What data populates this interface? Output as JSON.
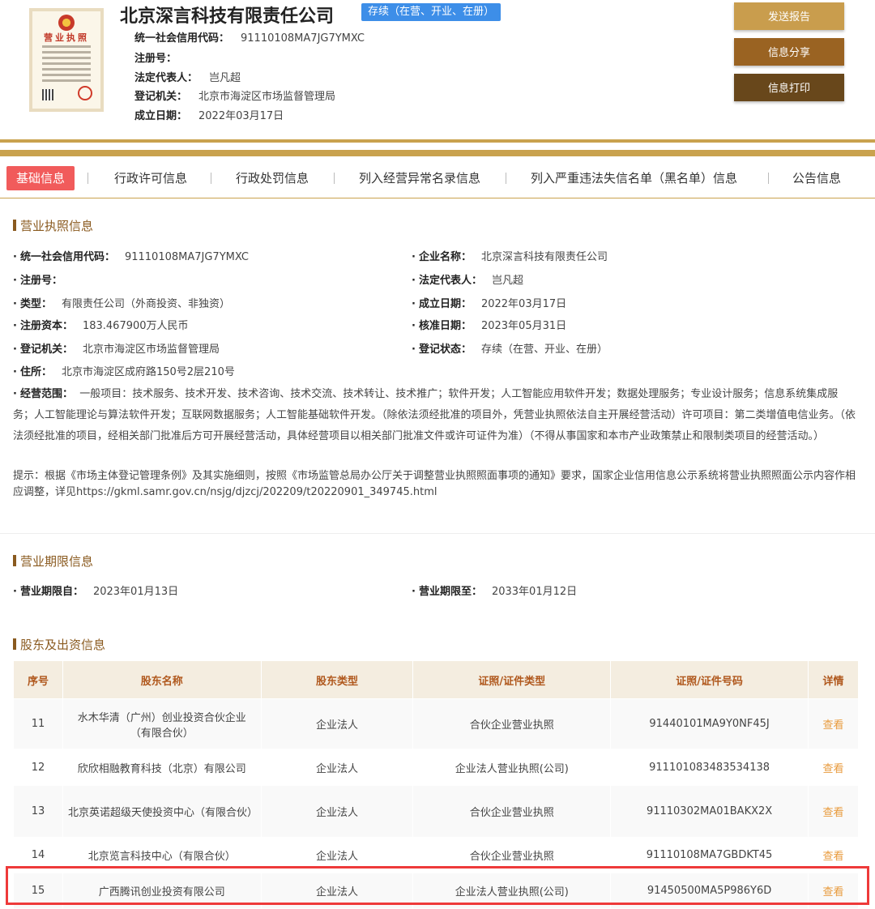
{
  "header": {
    "company_name": "北京深言科技有限责任公司",
    "status_badge": "存续（在营、开业、在册）",
    "rows": [
      {
        "label": "统一社会信用代码：",
        "value": "91110108MA7JG7YMXC"
      },
      {
        "label": "注册号：",
        "value": ""
      },
      {
        "label": "法定代表人：",
        "value": "岂凡超"
      },
      {
        "label": "登记机关：",
        "value": "北京市海淀区市场监督管理局"
      },
      {
        "label": "成立日期：",
        "value": "2022年03月17日"
      }
    ],
    "buttons": {
      "send_report": "发送报告",
      "share": "信息分享",
      "print": "信息打印"
    },
    "license_title": "营业执照"
  },
  "tabs": [
    "基础信息",
    "行政许可信息",
    "行政处罚信息",
    "列入经营异常名录信息",
    "列入严重违法失信名单（黑名单）信息",
    "公告信息"
  ],
  "license_section": {
    "title": "营业执照信息",
    "left": [
      {
        "label": "统一社会信用代码：",
        "value": "91110108MA7JG7YMXC"
      },
      {
        "label": "注册号：",
        "value": ""
      },
      {
        "label": "类型：",
        "value": "有限责任公司（外商投资、非独资）"
      },
      {
        "label": "注册资本：",
        "value": "183.467900万人民币"
      },
      {
        "label": "登记机关：",
        "value": "北京市海淀区市场监督管理局"
      },
      {
        "label": "住所：",
        "value": "北京市海淀区成府路150号2层210号"
      }
    ],
    "right": [
      {
        "label": "企业名称：",
        "value": "北京深言科技有限责任公司"
      },
      {
        "label": "法定代表人：",
        "value": "岂凡超"
      },
      {
        "label": "成立日期：",
        "value": "2022年03月17日"
      },
      {
        "label": "核准日期：",
        "value": "2023年05月31日"
      },
      {
        "label": "登记状态：",
        "value": "存续（在营、开业、在册）"
      }
    ],
    "scope_label": "经营范围：",
    "scope_value": "一般项目：技术服务、技术开发、技术咨询、技术交流、技术转让、技术推广；软件开发；人工智能应用软件开发；数据处理服务；专业设计服务；信息系统集成服务；人工智能理论与算法软件开发；互联网数据服务；人工智能基础软件开发。（除依法须经批准的项目外，凭营业执照依法自主开展经营活动）许可项目：第二类增值电信业务。（依法须经批准的项目，经相关部门批准后方可开展经营活动，具体经营项目以相关部门批准文件或许可证件为准）（不得从事国家和本市产业政策禁止和限制类项目的经营活动。）",
    "tip": "提示：根据《市场主体登记管理条例》及其实施细则，按照《市场监管总局办公厅关于调整营业执照照面事项的通知》要求，国家企业信用信息公示系统将营业执照照面公示内容作相应调整，详见https://gkml.samr.gov.cn/nsjg/djzcj/202209/t20220901_349745.html"
  },
  "term_section": {
    "title": "营业期限信息",
    "from_label": "营业期限自：",
    "from_value": "2023年01月13日",
    "to_label": "营业期限至：",
    "to_value": "2033年01月12日"
  },
  "holders_section": {
    "title": "股东及出资信息",
    "columns": [
      "序号",
      "股东名称",
      "股东类型",
      "证照/证件类型",
      "证照/证件号码",
      "详情"
    ],
    "rows": [
      {
        "no": "11",
        "name": "水木华清（广州）创业投资合伙企业（有限合伙）",
        "type": "企业法人",
        "cert_type": "合伙企业营业执照",
        "cert_no": "91440101MA9Y0NF45J",
        "detail": "查看"
      },
      {
        "no": "12",
        "name": "欣欣相融教育科技（北京）有限公司",
        "type": "企业法人",
        "cert_type": "企业法人营业执照(公司)",
        "cert_no": "91110108348353413​8",
        "detail": "查看"
      },
      {
        "no": "13",
        "name": "北京英诺超级天使投资中心（有限合伙）",
        "type": "企业法人",
        "cert_type": "合伙企业营业执照",
        "cert_no": "91110302MA01BAKX2X",
        "detail": "查看"
      },
      {
        "no": "14",
        "name": "北京览言科技中心（有限合伙）",
        "type": "企业法人",
        "cert_type": "合伙企业营业执照",
        "cert_no": "91110108MA7GBDKT45",
        "detail": "查看"
      },
      {
        "no": "15",
        "name": "广西腾讯创业投资有限公司",
        "type": "企业法人",
        "cert_type": "企业法人营业执照(公司)",
        "cert_no": "91450500MA5P986Y6D",
        "detail": "查看"
      }
    ]
  },
  "colors": {
    "accent_gold": "#c9a24e",
    "active_tab": "#f15b5b",
    "highlight": "#ee3a3a",
    "link": "#e89a3c"
  }
}
